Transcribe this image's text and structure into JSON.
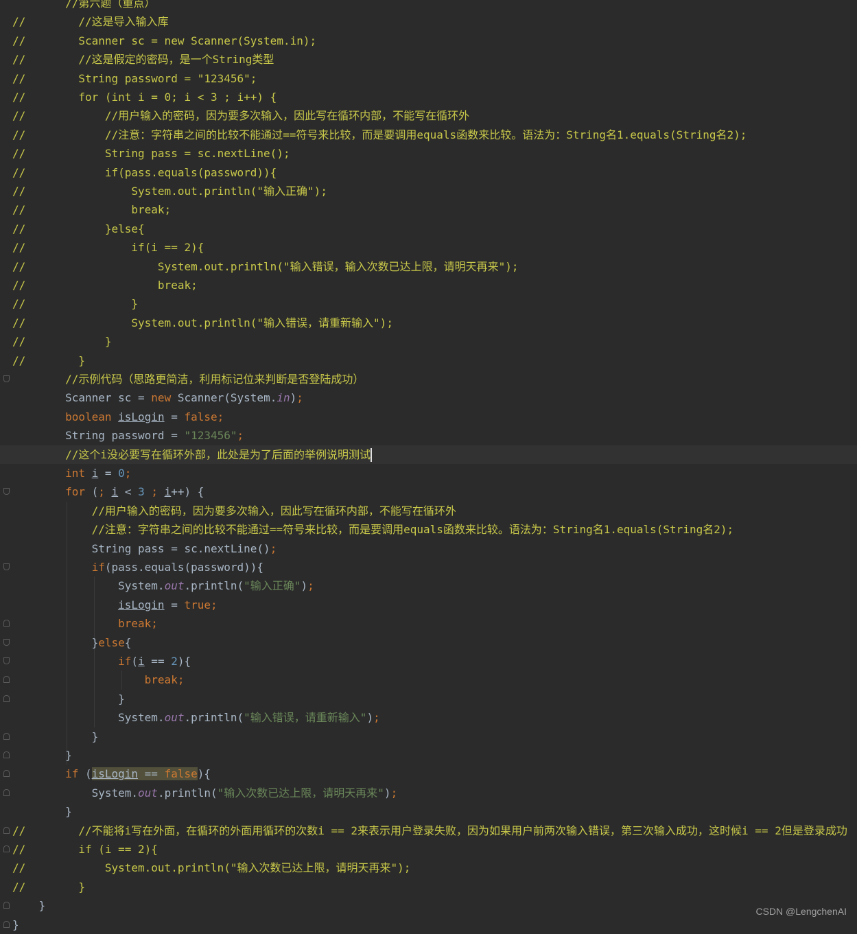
{
  "editor": {
    "lines": [
      [
        {
          "t": "        //第六题（重点）",
          "c": "comment"
        }
      ],
      [
        {
          "t": "//        //这是导入输入库",
          "c": "comment"
        }
      ],
      [
        {
          "t": "//        Scanner sc = new Scanner(System.in);",
          "c": "comment"
        }
      ],
      [
        {
          "t": "//        //这是假定的密码，是一个String类型",
          "c": "comment"
        }
      ],
      [
        {
          "t": "//        String password = \"123456\";",
          "c": "comment"
        }
      ],
      [
        {
          "t": "//        for (int i = 0; i < 3 ; i++) {",
          "c": "comment"
        }
      ],
      [
        {
          "t": "//            //用户输入的密码，因为要多次输入，因此写在循环内部，不能写在循环外",
          "c": "comment"
        }
      ],
      [
        {
          "t": "//            //注意：字符串之间的比较不能通过==符号来比较，而是要调用equals函数来比较。语法为：String名1.equals(String名2);",
          "c": "comment"
        }
      ],
      [
        {
          "t": "//            String pass = sc.nextLine();",
          "c": "comment"
        }
      ],
      [
        {
          "t": "//            if(pass.equals(password)){",
          "c": "comment"
        }
      ],
      [
        {
          "t": "//                System.out.println(\"输入正确\");",
          "c": "comment"
        }
      ],
      [
        {
          "t": "//                break;",
          "c": "comment"
        }
      ],
      [
        {
          "t": "//            }else{",
          "c": "comment"
        }
      ],
      [
        {
          "t": "//                if(i == 2){",
          "c": "comment"
        }
      ],
      [
        {
          "t": "//                    System.out.println(\"输入错误，输入次数已达上限，请明天再来\");",
          "c": "comment"
        }
      ],
      [
        {
          "t": "//                    break;",
          "c": "comment"
        }
      ],
      [
        {
          "t": "//                }",
          "c": "comment"
        }
      ],
      [
        {
          "t": "//                System.out.println(\"输入错误，请重新输入\");",
          "c": "comment"
        }
      ],
      [
        {
          "t": "//            }",
          "c": "comment"
        }
      ],
      [
        {
          "t": "//        }",
          "c": "comment"
        }
      ],
      [
        {
          "t": "        "
        },
        {
          "t": "//示例代码（思路更简洁，利用标记位来判断是否登陆成功）",
          "c": "comment"
        }
      ],
      [
        {
          "t": "        Scanner sc = "
        },
        {
          "t": "new",
          "c": "kw"
        },
        {
          "t": " Scanner(System."
        },
        {
          "t": "in",
          "c": "field"
        },
        {
          "t": ")"
        },
        {
          "t": ";",
          "c": "kw"
        }
      ],
      [
        {
          "t": "        "
        },
        {
          "t": "boolean",
          "c": "kw"
        },
        {
          "t": " "
        },
        {
          "t": "isLogin",
          "c": "var"
        },
        {
          "t": " = "
        },
        {
          "t": "false",
          "c": "kw"
        },
        {
          "t": ";",
          "c": "kw"
        }
      ],
      [
        {
          "t": "        String password = "
        },
        {
          "t": "\"123456\"",
          "c": "str"
        },
        {
          "t": ";",
          "c": "kw"
        }
      ],
      [
        {
          "t": "        "
        },
        {
          "t": "//这个i没必要写在循环外部，此处是为了后面的举例说明测试",
          "c": "comment"
        }
      ],
      [
        {
          "t": "        "
        },
        {
          "t": "int",
          "c": "kw"
        },
        {
          "t": " "
        },
        {
          "t": "i",
          "c": "var"
        },
        {
          "t": " = "
        },
        {
          "t": "0",
          "c": "num"
        },
        {
          "t": ";",
          "c": "kw"
        }
      ],
      [
        {
          "t": "        "
        },
        {
          "t": "for",
          "c": "kw"
        },
        {
          "t": " ("
        },
        {
          "t": ";",
          "c": "kw"
        },
        {
          "t": " "
        },
        {
          "t": "i",
          "c": "var"
        },
        {
          "t": " < "
        },
        {
          "t": "3",
          "c": "num"
        },
        {
          "t": " "
        },
        {
          "t": ";",
          "c": "kw"
        },
        {
          "t": " "
        },
        {
          "t": "i",
          "c": "var"
        },
        {
          "t": "++) {"
        }
      ],
      [
        {
          "t": "            "
        },
        {
          "t": "//用户输入的密码，因为要多次输入，因此写在循环内部，不能写在循环外",
          "c": "comment"
        }
      ],
      [
        {
          "t": "            "
        },
        {
          "t": "//注意：字符串之间的比较不能通过==符号来比较，而是要调用equals函数来比较。语法为：String名1.equals(String名2);",
          "c": "comment"
        }
      ],
      [
        {
          "t": "            String pass = sc.nextLine()"
        },
        {
          "t": ";",
          "c": "kw"
        }
      ],
      [
        {
          "t": "            "
        },
        {
          "t": "if",
          "c": "kw"
        },
        {
          "t": "(pass.equals(password)){"
        }
      ],
      [
        {
          "t": "                System."
        },
        {
          "t": "out",
          "c": "field"
        },
        {
          "t": ".println("
        },
        {
          "t": "\"输入正确\"",
          "c": "str"
        },
        {
          "t": ")"
        },
        {
          "t": ";",
          "c": "kw"
        }
      ],
      [
        {
          "t": "                "
        },
        {
          "t": "isLogin",
          "c": "var"
        },
        {
          "t": " = "
        },
        {
          "t": "true",
          "c": "kw"
        },
        {
          "t": ";",
          "c": "kw"
        }
      ],
      [
        {
          "t": "                "
        },
        {
          "t": "break;",
          "c": "kw"
        }
      ],
      [
        {
          "t": "            }"
        },
        {
          "t": "else",
          "c": "kw"
        },
        {
          "t": "{"
        }
      ],
      [
        {
          "t": "                "
        },
        {
          "t": "if",
          "c": "kw"
        },
        {
          "t": "("
        },
        {
          "t": "i",
          "c": "var"
        },
        {
          "t": " == "
        },
        {
          "t": "2",
          "c": "num"
        },
        {
          "t": "){"
        }
      ],
      [
        {
          "t": "                    "
        },
        {
          "t": "break;",
          "c": "kw"
        }
      ],
      [
        {
          "t": "                }"
        }
      ],
      [
        {
          "t": "                System."
        },
        {
          "t": "out",
          "c": "field"
        },
        {
          "t": ".println("
        },
        {
          "t": "\"输入错误，请重新输入\"",
          "c": "str"
        },
        {
          "t": ")"
        },
        {
          "t": ";",
          "c": "kw"
        }
      ],
      [
        {
          "t": "            }"
        }
      ],
      [
        {
          "t": "        }"
        }
      ],
      [
        {
          "t": "        "
        },
        {
          "t": "if",
          "c": "kw"
        },
        {
          "t": " ("
        },
        {
          "t": "isLogin",
          "c": "var hl"
        },
        {
          "t": " == ",
          "c": "hl"
        },
        {
          "t": "false",
          "c": "kw hl"
        },
        {
          "t": "){"
        }
      ],
      [
        {
          "t": "            System."
        },
        {
          "t": "out",
          "c": "field"
        },
        {
          "t": ".println("
        },
        {
          "t": "\"输入次数已达上限，请明天再来\"",
          "c": "str"
        },
        {
          "t": ")"
        },
        {
          "t": ";",
          "c": "kw"
        }
      ],
      [
        {
          "t": "        }"
        }
      ],
      [
        {
          "t": "//        //不能将i写在外面，在循环的外面用循环的次数i == 2来表示用户登录失败，因为如果用户前两次输入错误，第三次输入成功，这时候i == 2但是登录成功",
          "c": "comment"
        }
      ],
      [
        {
          "t": "//        if (i == 2){",
          "c": "comment"
        }
      ],
      [
        {
          "t": "//            System.out.println(\"输入次数已达上限，请明天再来\");",
          "c": "comment"
        }
      ],
      [
        {
          "t": "//        }",
          "c": "comment"
        }
      ],
      [
        {
          "t": "    }"
        }
      ],
      [
        {
          "t": "}"
        }
      ]
    ]
  },
  "watermark": "CSDN @LengchenAI"
}
